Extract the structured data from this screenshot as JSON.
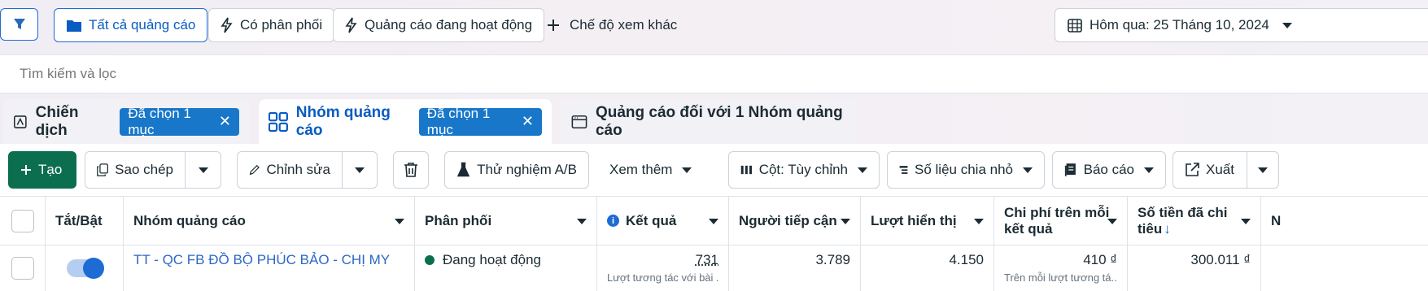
{
  "top_bar": {
    "all_ads": "Tất cả quảng cáo",
    "has_delivery": "Có phân phối",
    "active_ads": "Quảng cáo đang hoạt động",
    "other_views": "Chế độ xem khác",
    "date_range": "Hôm qua: 25 Tháng 10, 2024"
  },
  "search": {
    "placeholder": "Tìm kiếm và lọc"
  },
  "tabs": [
    {
      "label": "Chiến dịch",
      "chip": "Đã chọn 1 mục"
    },
    {
      "label": "Nhóm quảng cáo",
      "chip": "Đã chọn 1 mục"
    },
    {
      "label": "Quảng cáo đối với 1 Nhóm quảng cáo"
    }
  ],
  "toolbar": {
    "create": "Tạo",
    "duplicate": "Sao chép",
    "edit": "Chỉnh sửa",
    "ab_test": "Thử nghiệm A/B",
    "see_more": "Xem thêm",
    "columns": "Cột: Tùy chỉnh",
    "breakdown": "Số liệu chia nhỏ",
    "reports": "Báo cáo",
    "export": "Xuất"
  },
  "table": {
    "headers": {
      "toggle": "Tắt/Bật",
      "adset": "Nhóm quảng cáo",
      "delivery": "Phân phối",
      "results": "Kết quả",
      "reach": "Người tiếp cận",
      "impressions": "Lượt hiển thị",
      "cost_per_result_1": "Chi phí trên mỗi",
      "cost_per_result_2": "kết quả",
      "amount_spent_1": "Số tiền đã chi",
      "amount_spent_2": "tiêu",
      "next": "N"
    },
    "row": {
      "adset_name": "TT - QC FB ĐỒ BỘ PHÚC BẢO - CHỊ MY",
      "delivery": "Đang hoạt động",
      "results": "731",
      "results_sub": "Lượt tương tác với bài ...",
      "reach": "3.789",
      "impressions": "4.150",
      "cost_per_result": "410 ₫",
      "cost_sub": "Trên mỗi lượt tương tá...",
      "amount_spent": "300.011 ₫",
      "toggle_on": true
    }
  },
  "colors": {
    "accent": "#1877c9",
    "create": "#0b6e4f",
    "status_active": "#0b6e4f",
    "link": "#1d6bd3"
  }
}
